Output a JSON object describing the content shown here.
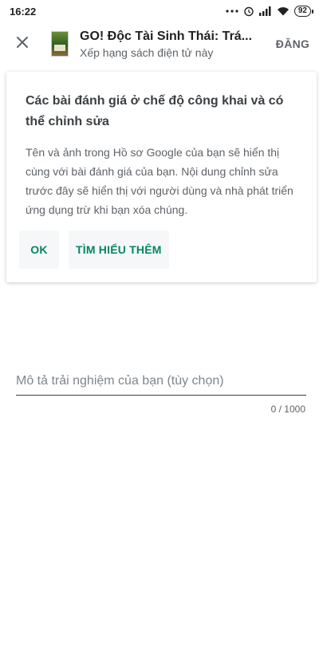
{
  "status_bar": {
    "time": "16:22",
    "battery": "92",
    "icons": [
      "more-dots-icon",
      "alarm-icon",
      "signal-icon",
      "wifi-icon",
      "battery-icon"
    ]
  },
  "header": {
    "close_icon": "close-icon",
    "title": "GO! Độc Tài Sinh Thái: Trá...",
    "subtitle": "Xếp hạng sách điện tử này",
    "post_label": "ĐĂNG"
  },
  "card": {
    "title": "Các bài đánh giá ở chế độ công khai và có thể chỉnh sửa",
    "body": "Tên và ảnh trong Hồ sơ Google của bạn sẽ hiển thị cùng với bài đánh giá của bạn. Nội dung chỉnh sửa trước đây sẽ hiển thị với người dùng và nhà phát triển ứng dụng trừ khi bạn xóa chúng.",
    "ok_label": "OK",
    "learn_more_label": "TÌM HIỂU THÊM"
  },
  "review": {
    "placeholder": "Mô tả trải nghiệm của bạn (tùy chọn)",
    "char_count": "0 / 1000"
  },
  "colors": {
    "accent": "#01875f",
    "text_primary": "#202124",
    "text_secondary": "#5f6368",
    "button_bg": "#f6f7f8"
  }
}
